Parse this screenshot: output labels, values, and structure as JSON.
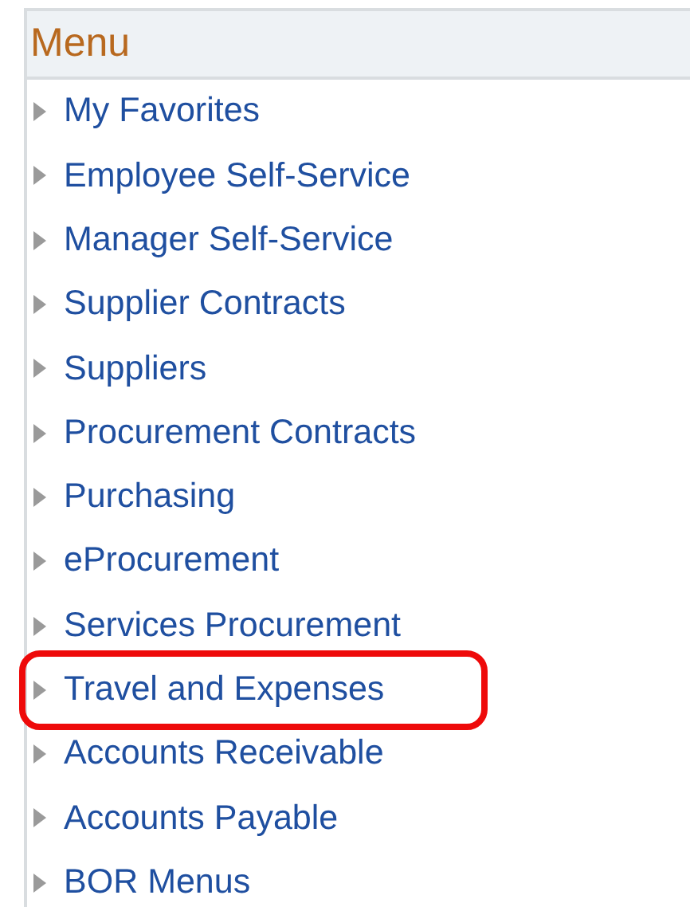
{
  "menu": {
    "title": "Menu",
    "items": [
      {
        "label": "My Favorites",
        "highlighted": false
      },
      {
        "label": "Employee Self-Service",
        "highlighted": false
      },
      {
        "label": "Manager Self-Service",
        "highlighted": false
      },
      {
        "label": "Supplier Contracts",
        "highlighted": false
      },
      {
        "label": "Suppliers",
        "highlighted": false
      },
      {
        "label": "Procurement Contracts",
        "highlighted": false
      },
      {
        "label": "Purchasing",
        "highlighted": false
      },
      {
        "label": "eProcurement",
        "highlighted": false
      },
      {
        "label": "Services Procurement",
        "highlighted": false
      },
      {
        "label": "Travel and Expenses",
        "highlighted": true
      },
      {
        "label": "Accounts Receivable",
        "highlighted": false
      },
      {
        "label": "Accounts Payable",
        "highlighted": false
      },
      {
        "label": "BOR Menus",
        "highlighted": false
      }
    ]
  }
}
